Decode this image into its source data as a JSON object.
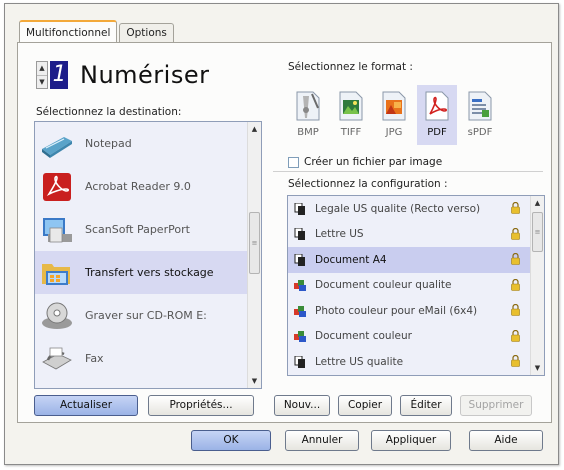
{
  "tabs": [
    {
      "label": "Multifonctionnel",
      "active": true
    },
    {
      "label": "Options",
      "active": false
    }
  ],
  "scan_button": {
    "number": "1",
    "title": "Numériser"
  },
  "destination": {
    "label": "Sélectionnez la destination:",
    "items": [
      {
        "label": "Notepad",
        "icon": "notepad-icon",
        "selected": false
      },
      {
        "label": "Acrobat Reader 9.0",
        "icon": "acrobat-icon",
        "selected": false
      },
      {
        "label": "ScanSoft PaperPort",
        "icon": "paperport-icon",
        "selected": false
      },
      {
        "label": "Transfert vers stockage",
        "icon": "folder-storage-icon",
        "selected": true
      },
      {
        "label": "Graver sur CD-ROM  E:",
        "icon": "cd-rom-icon",
        "selected": false
      },
      {
        "label": "Fax",
        "icon": "fax-icon",
        "selected": false
      }
    ],
    "buttons": {
      "refresh": "Actualiser",
      "properties": "Propriétés..."
    }
  },
  "format": {
    "label": "Sélectionnez le format :",
    "items": [
      {
        "label": "BMP",
        "selected": false
      },
      {
        "label": "TIFF",
        "selected": false
      },
      {
        "label": "JPG",
        "selected": false
      },
      {
        "label": "PDF",
        "selected": true
      },
      {
        "label": "sPDF",
        "selected": false
      }
    ],
    "checkbox_label": "Créer un fichier par image",
    "checkbox_checked": false
  },
  "configuration": {
    "label": "Sélectionnez la configuration :",
    "items": [
      {
        "label": "Legale US qualite (Recto verso)",
        "icon": "bw-page-icon",
        "selected": false
      },
      {
        "label": "Lettre US",
        "icon": "bw-page-icon",
        "selected": false
      },
      {
        "label": "Document A4",
        "icon": "bw-page-icon",
        "selected": true
      },
      {
        "label": "Document couleur qualite",
        "icon": "color-page-icon",
        "selected": false
      },
      {
        "label": "Photo couleur pour eMail (6x4)",
        "icon": "color-page-icon",
        "selected": false
      },
      {
        "label": "Document couleur",
        "icon": "color-page-icon",
        "selected": false
      },
      {
        "label": "Lettre US qualite",
        "icon": "bw-page-icon",
        "selected": false
      }
    ],
    "buttons": {
      "new": "Nouv...",
      "copy": "Copier",
      "edit": "Éditer",
      "delete": "Supprimer"
    }
  },
  "dialog_buttons": {
    "ok": "OK",
    "cancel": "Annuler",
    "apply": "Appliquer",
    "help": "Aide"
  },
  "colors": {
    "selection": "#d7d9f2",
    "tab_accent": "#f3a93a",
    "lcd": "#1d1d8a"
  }
}
